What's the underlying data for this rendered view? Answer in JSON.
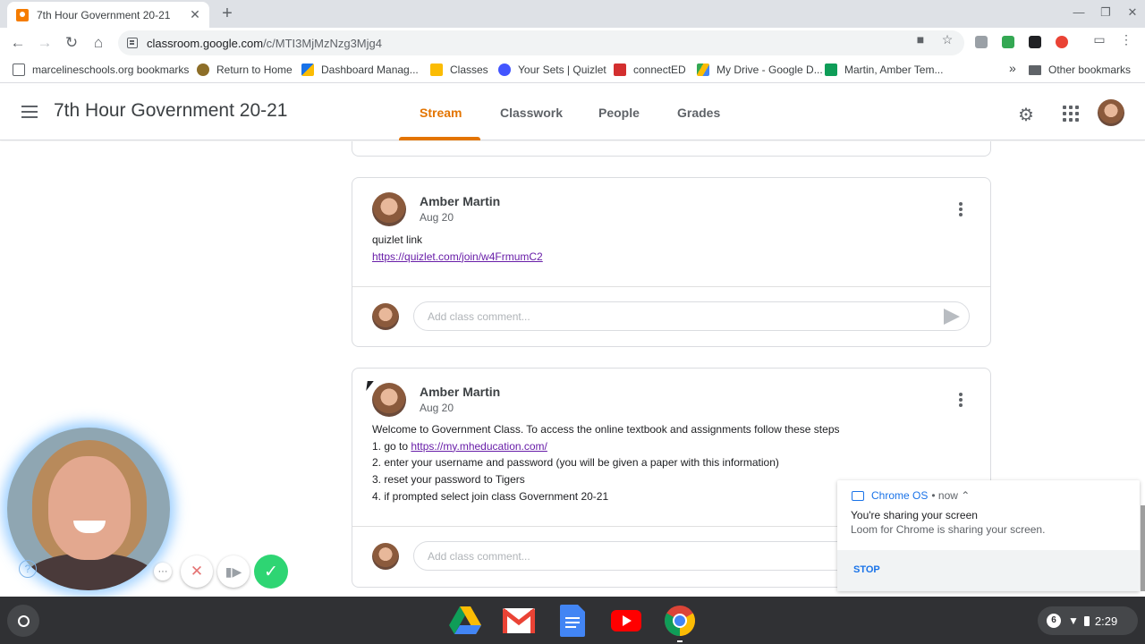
{
  "browser": {
    "tab_title": "7th Hour Government 20-21",
    "tab_close": "✕",
    "new_tab": "+",
    "url_domain": "classroom.google.com",
    "url_path": "/c/MTI3MjMzNzg3Mjg4"
  },
  "bookmarks": [
    {
      "label": "marcelineschools.org bookmarks",
      "icon": "folder-icon"
    },
    {
      "label": "Return to Home",
      "icon": "home-bookmark-icon"
    },
    {
      "label": "Dashboard Manag...",
      "icon": "dashboard-icon"
    },
    {
      "label": "Classes",
      "icon": "classes-icon"
    },
    {
      "label": "Your Sets | Quizlet",
      "icon": "quizlet-icon"
    },
    {
      "label": "connectED",
      "icon": "connected-icon"
    },
    {
      "label": "My Drive - Google D...",
      "icon": "drive-icon"
    },
    {
      "label": "Martin, Amber Tem...",
      "icon": "sheets-icon"
    }
  ],
  "bookmarks_overflow": "»",
  "other_bookmarks": "Other bookmarks",
  "classroom": {
    "title": "7th Hour Government 20-21",
    "tabs": [
      "Stream",
      "Classwork",
      "People",
      "Grades"
    ],
    "active_tab": "Stream"
  },
  "posts": [
    {
      "author": "Amber Martin",
      "date": "Aug 20",
      "lines": [
        "quizlet link"
      ],
      "link": "https://quizlet.com/join/w4FrmumC2",
      "comment_placeholder": "Add class comment..."
    },
    {
      "author": "Amber Martin",
      "date": "Aug 20",
      "line1": "Welcome to Government Class. To access the online textbook and assignments follow these steps",
      "line2_prefix": "1. go to ",
      "line2_link": "https://my.mheducation.com/",
      "line3": "2. enter your username and password (you will be given a paper with this information)",
      "line4": "3. reset your password to Tigers",
      "line5": "4. if prompted select join class Government 20-21",
      "comment_placeholder": "Add class comment..."
    }
  ],
  "notification": {
    "source": "Chrome OS",
    "time": "• now ⌃",
    "title": "You're sharing your screen",
    "body": "Loom for Chrome is sharing your screen.",
    "action": "STOP"
  },
  "shelf": {
    "apps": [
      "google-drive-icon",
      "gmail-icon",
      "google-docs-icon",
      "youtube-icon",
      "chrome-icon"
    ],
    "notification_count": "6",
    "time": "2:29"
  },
  "colors": {
    "accent": "#e37400",
    "link": "#1a0dab",
    "loom_confirm": "#2ed573"
  }
}
